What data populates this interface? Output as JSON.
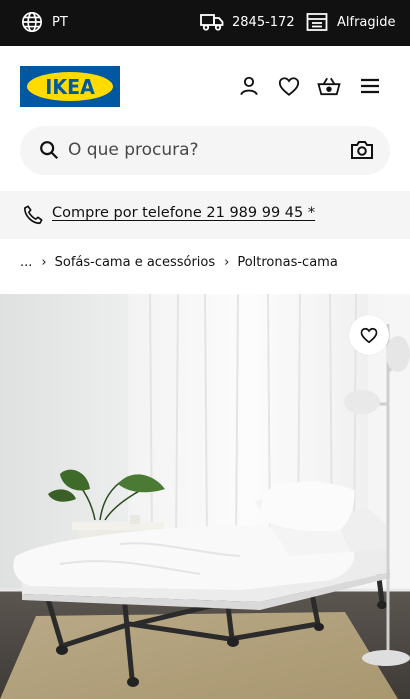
{
  "topbar": {
    "language": "PT",
    "delivery_code": "2845-172",
    "store": "Alfragide"
  },
  "header": {
    "logo_text": "IKEA",
    "icons": [
      "user-icon",
      "heart-icon",
      "basket-icon",
      "menu-icon"
    ]
  },
  "search": {
    "placeholder": "O que procura?"
  },
  "phone_banner": {
    "text": "Compre por telefone 21 989 99 45 *"
  },
  "breadcrumb": {
    "ellipsis": "...",
    "items": [
      "Sofás-cama e acessórios",
      "Poltronas-cama"
    ]
  },
  "colors": {
    "topbar_bg": "#111111",
    "ikea_blue": "#0058a3",
    "ikea_yellow": "#ffdb00",
    "search_bg": "#f5f5f5"
  }
}
